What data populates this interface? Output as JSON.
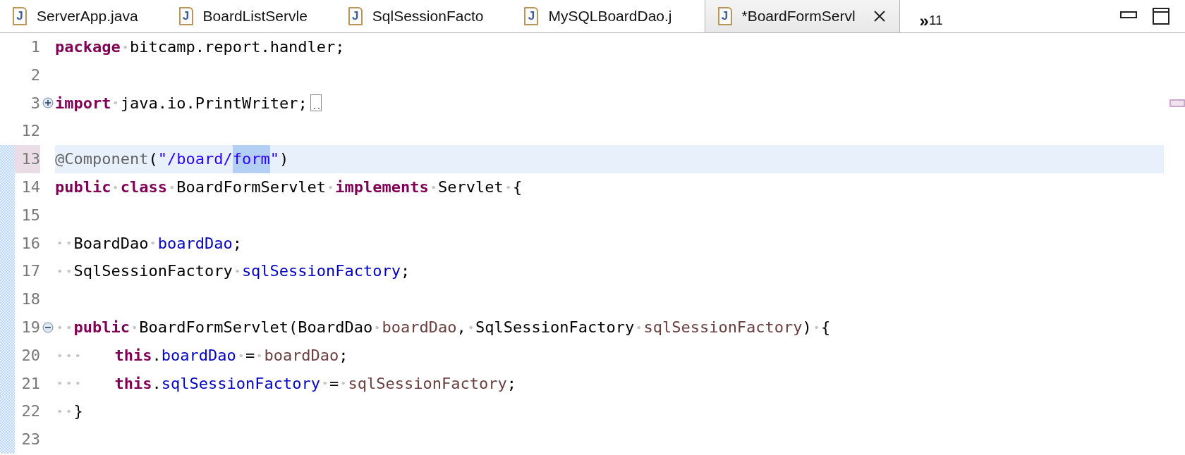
{
  "tabs": [
    {
      "icon": "J",
      "label": "ServerApp.java",
      "selected": false
    },
    {
      "icon": "J",
      "label": "BoardListServle",
      "selected": false
    },
    {
      "icon": "J",
      "label": "SqlSessionFacto",
      "selected": false
    },
    {
      "icon": "J",
      "label": "MySQLBoardDao.j",
      "selected": false
    },
    {
      "icon": "J",
      "label": "*BoardFormServl",
      "selected": true
    }
  ],
  "overflow": {
    "symbol": "»",
    "count": "11"
  },
  "editor": {
    "lines": [
      {
        "number": "1",
        "current": false,
        "changed": false,
        "indented": false,
        "tokens": [
          {
            "kind": "keyword",
            "text": "package",
            "spaced": false
          },
          {
            "kind": "plain",
            "text": "bitcamp.report.handler;",
            "spaced": true
          }
        ]
      },
      {
        "number": "2",
        "current": false,
        "changed": false
      },
      {
        "number": "3",
        "current": false,
        "changed": false,
        "collapsed": true,
        "overview_mark": true,
        "indented": false,
        "tokens": [
          {
            "kind": "keyword",
            "text": "import",
            "spaced": false
          },
          {
            "kind": "plain",
            "text": "java.io.PrintWriter;",
            "spaced": true
          }
        ]
      },
      {
        "number": "12",
        "current": false,
        "changed": false
      },
      {
        "number": "13",
        "current": true,
        "changed": true,
        "indented": false,
        "tokens": [
          {
            "kind": "annotation",
            "text": "@Component",
            "spaced": false
          },
          {
            "kind": "plain",
            "text": "(",
            "spaced": false
          },
          {
            "kind": "string",
            "text": "\"/board/",
            "spaced": false
          },
          {
            "kind": "selected-string",
            "text": "form",
            "spaced": false
          },
          {
            "kind": "string",
            "text": "\"",
            "spaced": false
          },
          {
            "kind": "plain",
            "text": ")",
            "spaced": false
          }
        ]
      },
      {
        "number": "14",
        "current": false,
        "changed": true,
        "indented": false,
        "tokens": [
          {
            "kind": "keyword",
            "text": "public",
            "spaced": false
          },
          {
            "kind": "keyword",
            "text": "class",
            "spaced": true
          },
          {
            "kind": "plain",
            "text": "BoardFormServlet",
            "spaced": true
          },
          {
            "kind": "keyword",
            "text": "implements",
            "spaced": true
          },
          {
            "kind": "plain",
            "text": "Servlet",
            "spaced": true
          },
          {
            "kind": "plain",
            "text": "{",
            "spaced": true
          }
        ]
      },
      {
        "number": "15",
        "current": false,
        "changed": true
      },
      {
        "number": "16",
        "current": false,
        "changed": true,
        "indented": true,
        "nested": false,
        "tokens": [
          {
            "kind": "plain",
            "text": "BoardDao",
            "spaced": false
          },
          {
            "kind": "field",
            "text": "boardDao",
            "spaced": true
          },
          {
            "kind": "plain",
            "text": ";",
            "spaced": false
          }
        ]
      },
      {
        "number": "17",
        "current": false,
        "changed": true,
        "indented": true,
        "nested": false,
        "tokens": [
          {
            "kind": "plain",
            "text": "SqlSessionFactory",
            "spaced": false
          },
          {
            "kind": "field",
            "text": "sqlSessionFactory",
            "spaced": true
          },
          {
            "kind": "plain",
            "text": ";",
            "spaced": false
          }
        ]
      },
      {
        "number": "18",
        "current": false,
        "changed": true
      },
      {
        "number": "19",
        "current": false,
        "changed": true,
        "collapsed": false,
        "indented": true,
        "nested": false,
        "tokens": [
          {
            "kind": "keyword",
            "text": "public",
            "spaced": false
          },
          {
            "kind": "plain",
            "text": "BoardFormServlet(BoardDao",
            "spaced": true
          },
          {
            "kind": "param",
            "text": "boardDao",
            "spaced": true
          },
          {
            "kind": "plain",
            "text": ",",
            "spaced": false
          },
          {
            "kind": "plain",
            "text": "SqlSessionFactory",
            "spaced": true
          },
          {
            "kind": "param",
            "text": "sqlSessionFactory",
            "spaced": true
          },
          {
            "kind": "plain",
            "text": ")",
            "spaced": false
          },
          {
            "kind": "plain",
            "text": "{",
            "spaced": true
          }
        ]
      },
      {
        "number": "20",
        "current": false,
        "changed": true,
        "indented": true,
        "nested": true,
        "tokens": [
          {
            "kind": "keyword",
            "text": "this",
            "spaced": false
          },
          {
            "kind": "plain",
            "text": ".",
            "spaced": false
          },
          {
            "kind": "field",
            "text": "boardDao",
            "spaced": false
          },
          {
            "kind": "plain",
            "text": "=",
            "spaced": true
          },
          {
            "kind": "param",
            "text": "boardDao",
            "spaced": true
          },
          {
            "kind": "plain",
            "text": ";",
            "spaced": false
          }
        ]
      },
      {
        "number": "21",
        "current": false,
        "changed": true,
        "indented": true,
        "nested": true,
        "tokens": [
          {
            "kind": "keyword",
            "text": "this",
            "spaced": false
          },
          {
            "kind": "plain",
            "text": ".",
            "spaced": false
          },
          {
            "kind": "field",
            "text": "sqlSessionFactory",
            "spaced": false
          },
          {
            "kind": "plain",
            "text": "=",
            "spaced": true
          },
          {
            "kind": "param",
            "text": "sqlSessionFactory",
            "spaced": true
          },
          {
            "kind": "plain",
            "text": ";",
            "spaced": false
          }
        ]
      },
      {
        "number": "22",
        "current": false,
        "changed": true,
        "indented": true,
        "nested": false,
        "tokens": [
          {
            "kind": "plain",
            "text": "}",
            "spaced": false
          }
        ]
      },
      {
        "number": "23",
        "current": false,
        "changed": true
      }
    ]
  }
}
